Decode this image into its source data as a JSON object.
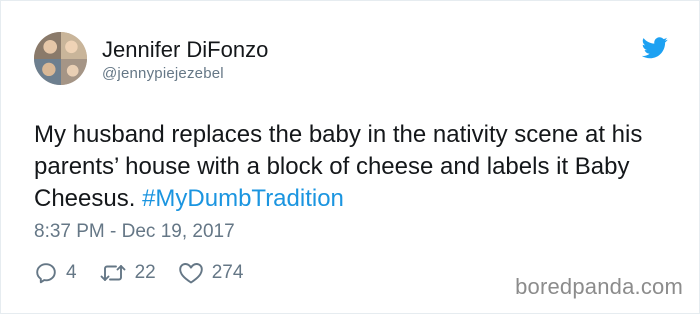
{
  "tweet": {
    "author_name": "Jennifer DiFonzo",
    "author_handle": "@jennypiejezebel",
    "text_main": "My husband replaces the baby in the nativity scene at his parents’ house with a block of cheese and labels it Baby Cheesus. ",
    "hashtag": "#MyDumbTradition",
    "timestamp": "8:37 PM - Dec 19, 2017"
  },
  "actions": {
    "replies": "4",
    "retweets": "22",
    "likes": "274"
  },
  "icons": {
    "brand": "twitter-bird-icon",
    "reply": "reply-icon",
    "retweet": "retweet-icon",
    "like": "heart-icon"
  },
  "colors": {
    "brand_blue": "#1da1f2",
    "hashtag": "#1b95e0",
    "muted": "#657786",
    "text": "#14171a"
  },
  "watermark": "boredpanda.com"
}
